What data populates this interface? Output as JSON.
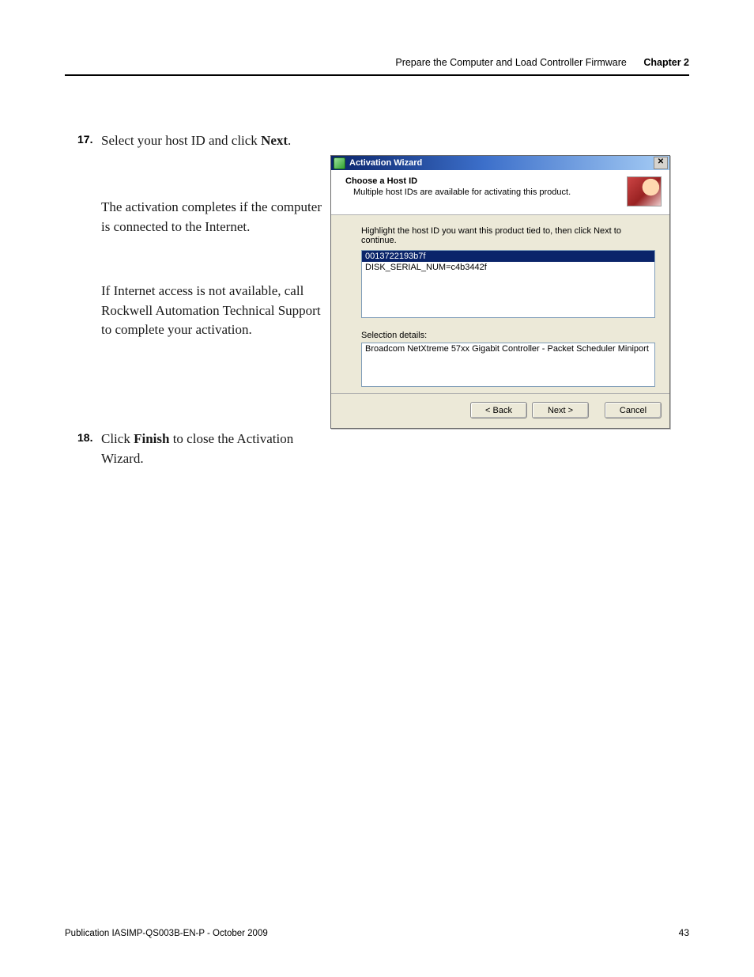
{
  "header": {
    "section_title": "Prepare the Computer and Load Controller Firmware",
    "chapter_label": "Chapter 2"
  },
  "steps": {
    "s17": {
      "num": "17",
      "line1_a": "Select your host ID and click ",
      "line1_b": "Next",
      "line1_c": ".",
      "para2": "The activation completes if the computer is connected to the Internet.",
      "para3": "If Internet access is not available, call Rockwell Automation Technical Support to complete your activation."
    },
    "s18": {
      "num": "18",
      "a": "Click ",
      "b": "Finish",
      "c": " to close the Activation Wizard."
    }
  },
  "dialog": {
    "title": "Activation Wizard",
    "close_glyph": "✕",
    "header_title": "Choose a Host ID",
    "header_sub": "Multiple host IDs are available for activating this product.",
    "instruction": "Highlight the host ID you want this product tied to, then click Next to continue.",
    "host_ids": {
      "selected": "0013722193b7f",
      "other": "DISK_SERIAL_NUM=c4b3442f"
    },
    "selection_details_label": "Selection details:",
    "selection_details_value": "Broadcom NetXtreme 57xx Gigabit Controller - Packet Scheduler Miniport",
    "buttons": {
      "back": "< Back",
      "next": "Next >",
      "cancel": "Cancel"
    }
  },
  "footer": {
    "publication": "Publication IASIMP-QS003B-EN-P - October 2009",
    "page": "43"
  }
}
